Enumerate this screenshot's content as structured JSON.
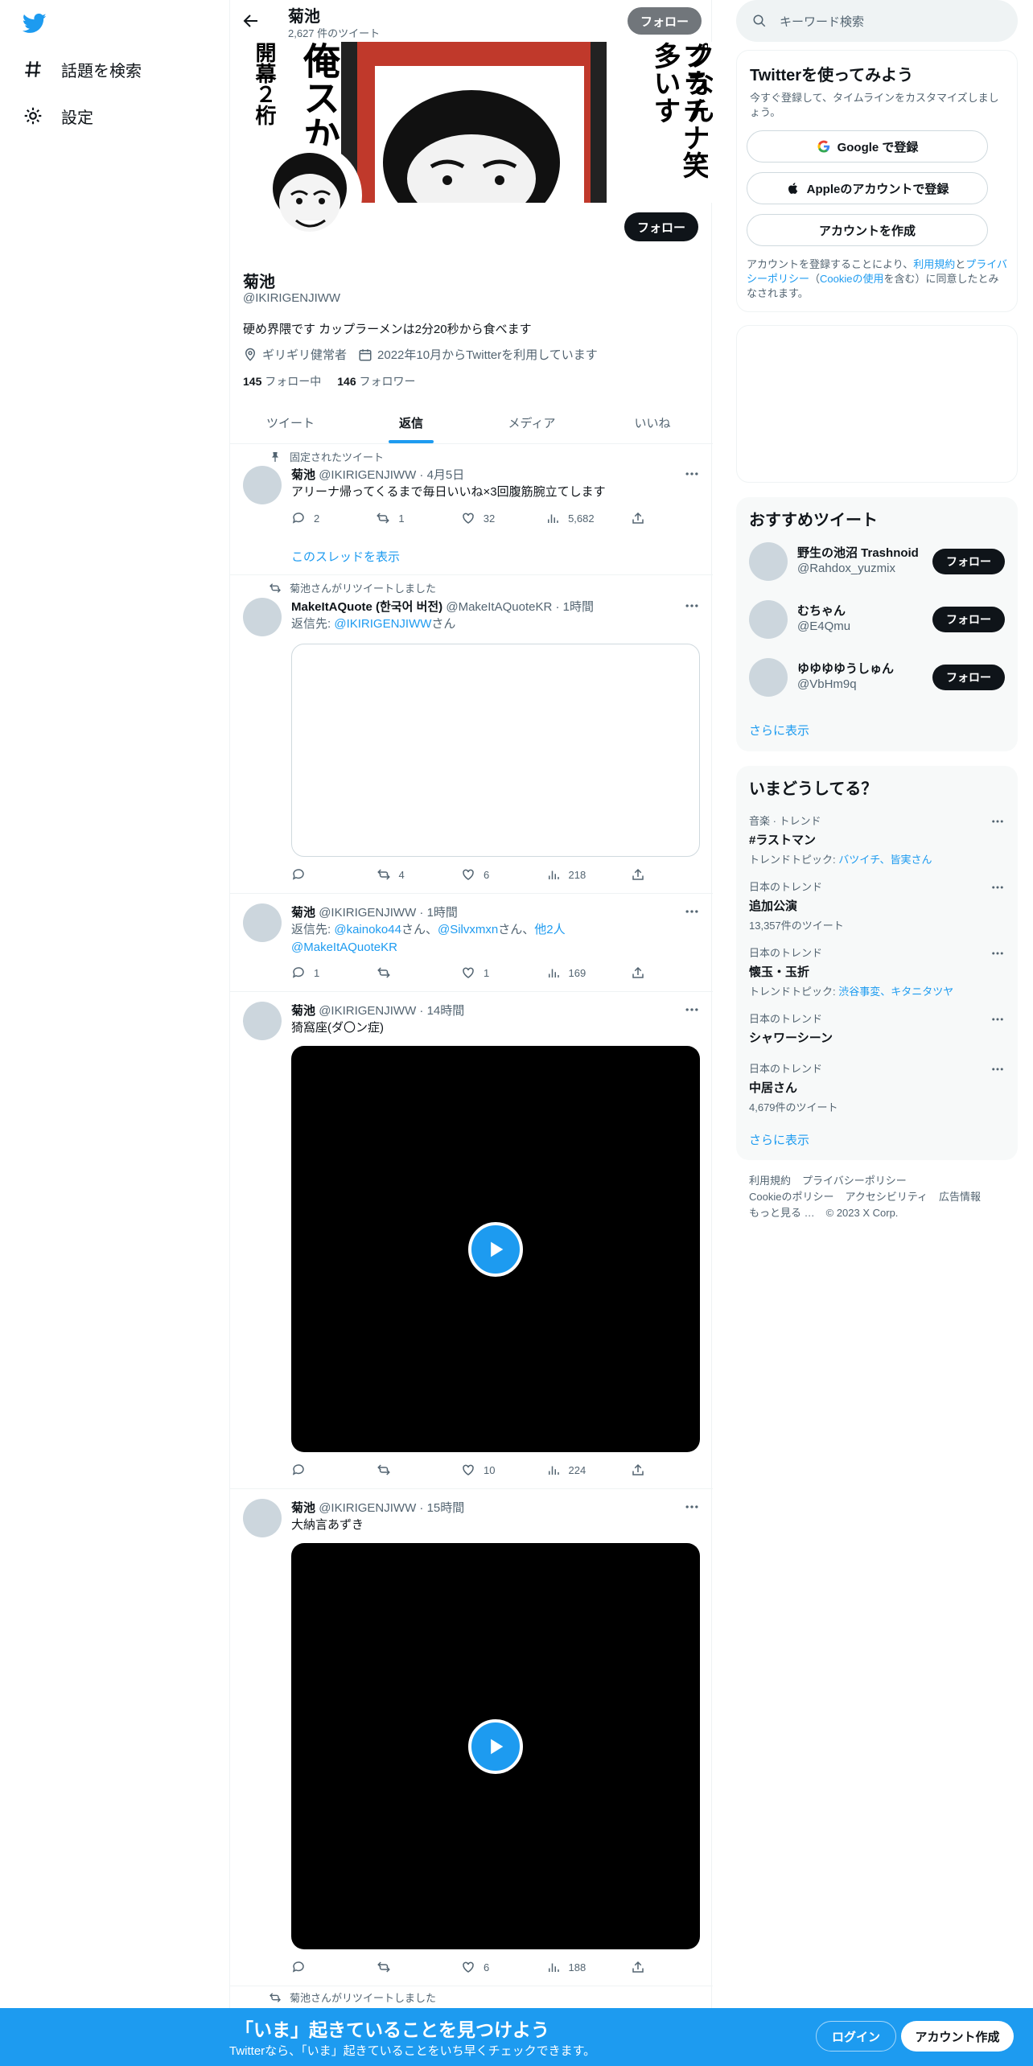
{
  "nav": {
    "explore_label": "話題を検索",
    "settings_label": "設定"
  },
  "header": {
    "name": "菊池",
    "tweet_count": "2,627 件のツイート",
    "follow_label": "フォロー"
  },
  "profile": {
    "name": "菊池",
    "handle": "@IKIRIGENJIWW",
    "bio": "硬め界隈です カップラーメンは2分20秒から食べます",
    "location": "ギリギリ健常者",
    "joined": "2022年10月からTwitterを利用しています",
    "following_count": "145",
    "following_label": "フォロー中",
    "followers_count": "146",
    "followers_label": "フォロワー",
    "follow_label": "フォロー",
    "banner_text_left": "開幕２桁",
    "banner_text_mid": "俺スか",
    "banner_text_right1": "どんはランクなん",
    "banner_text_right2": "プラチナ笑　多いす"
  },
  "tabs": [
    {
      "label": "ツイート"
    },
    {
      "label": "返信"
    },
    {
      "label": "メディア"
    },
    {
      "label": "いいね"
    }
  ],
  "tweets": [
    {
      "topline": "固定されたツイート",
      "name": "菊池",
      "meta": "@IKIRIGENJIWW · 4月5日",
      "text": "アリーナ帰ってくるまで毎日いいね×3回腹筋腕立てします",
      "reply": "2",
      "retweet": "1",
      "like": "32",
      "views": "5,682",
      "show_thread": "このスレッドを表示"
    },
    {
      "topline": "菊池さんがリツイートしました",
      "name": "MakeItAQuote (한국어 버전)",
      "meta": "@MakeItAQuoteKR · 1時間",
      "reply_prefix": "返信先: ",
      "reply_to": "@IKIRIGENJIWW",
      "reply_suffix": "さん",
      "reply": "",
      "retweet": "4",
      "like": "6",
      "views": "218"
    },
    {
      "name": "菊池",
      "meta": "@IKIRIGENJIWW · 1時間",
      "reply_prefix": "返信先: ",
      "reply_to1": "@kainoko44",
      "sep1": "さん、",
      "reply_to2": "@Silvxmxn",
      "sep2": "さん、",
      "reply_to3": "他2人",
      "reply_to4": "@MakeItAQuoteKR",
      "reply": "1",
      "retweet": "",
      "like": "1",
      "views": "169"
    },
    {
      "name": "菊池",
      "meta": "@IKIRIGENJIWW · 14時間",
      "text": "猗窩座(ダ〇ン症)",
      "reply": "",
      "retweet": "",
      "like": "10",
      "views": "224"
    },
    {
      "name": "菊池",
      "meta": "@IKIRIGENJIWW · 15時間",
      "text": "大納言あずき",
      "reply": "",
      "retweet": "",
      "like": "6",
      "views": "188"
    },
    {
      "topline": "菊池さんがリツイートしました"
    }
  ],
  "right": {
    "search_placeholder": "キーワード検索",
    "signup": {
      "title": "Twitterを使ってみよう",
      "subtitle": "今すぐ登録して、タイムラインをカスタマイズしましょう。",
      "google": "Google で登録",
      "apple": "Appleのアカウントで登録",
      "create": "アカウントを作成",
      "terms_1": "アカウントを登録することにより、",
      "terms_link1": "利用規約",
      "terms_2": "と",
      "terms_link2": "プライバシーポリシー",
      "terms_3": "（",
      "terms_link3": "Cookieの使用",
      "terms_4": "を含む）に同意したとみなされます。"
    },
    "who": {
      "title": "おすすめツイート",
      "users": [
        {
          "name": "野生の池沼 Trashnoid",
          "handle": "@Rahdox_yuzmix",
          "button": "フォロー"
        },
        {
          "name": "むちゃん",
          "handle": "@E4Qmu",
          "button": "フォロー"
        },
        {
          "name": "ゆゆゆゆうしゅん",
          "handle": "@VbHm9q",
          "button": "フォロー"
        }
      ],
      "more": "さらに表示"
    },
    "trends": {
      "title": "いまどうしてる？",
      "items": [
        {
          "category": "音楽 · トレンド",
          "name": "#ラストマン",
          "sub_prefix": "トレンドトピック: ",
          "sub_links": "バツイチ、皆実さん"
        },
        {
          "category": "日本のトレンド",
          "name": "追加公演",
          "sub": "13,357件のツイート"
        },
        {
          "category": "日本のトレンド",
          "name": "懐玉・玉折",
          "sub_prefix": "トレンドトピック: ",
          "sub_links": "渋谷事変、キタニタツヤ"
        },
        {
          "category": "日本のトレンド",
          "name": "シャワーシーン"
        },
        {
          "category": "日本のトレンド",
          "name": "中居さん",
          "sub": "4,679件のツイート"
        }
      ],
      "more": "さらに表示"
    },
    "footer": {
      "l1": "利用規約",
      "l2": "プライバシーポリシー",
      "l3": "Cookieのポリシー",
      "l4": "アクセシビリティ",
      "l5": "広告情報",
      "l6": "もっと見る …",
      "l7": "© 2023 X Corp."
    }
  },
  "bottom": {
    "title": "「いま」起きていることを見つけよう",
    "subtitle": "Twitterなら、「いま」起きていることをいち早くチェックできます。",
    "login": "ログイン",
    "signup": "アカウント作成"
  },
  "colors": {
    "accent": "#1d9bf0",
    "text": "#0f1419",
    "muted": "#536471"
  }
}
